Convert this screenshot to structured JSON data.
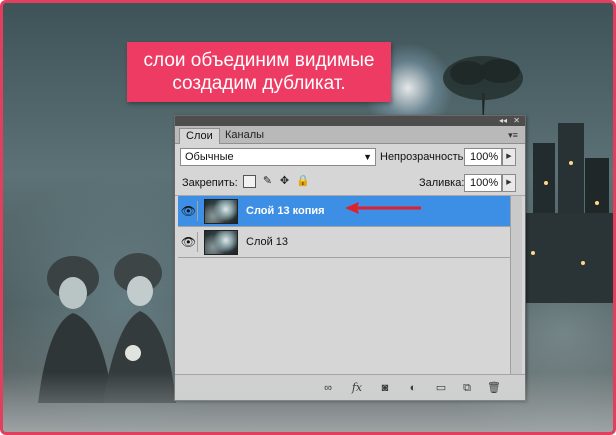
{
  "caption": {
    "line1": "слои объединим видимые",
    "line2": "создадим дубликат."
  },
  "panel": {
    "top_controls": [
      "◂◂",
      "✕"
    ],
    "tabs": [
      {
        "label": "Слои",
        "active": true
      },
      {
        "label": "Каналы",
        "active": false
      }
    ],
    "menu_icon": "panel-menu-icon",
    "blend_mode": "Обычные",
    "opacity_label": "Непрозрачность:",
    "opacity_value": "100%",
    "lock_label": "Закрепить:",
    "fill_label": "Заливка:",
    "fill_value": "100%",
    "layers": [
      {
        "name": "Слой 13 копия",
        "selected": true,
        "visible": true
      },
      {
        "name": "Слой 13",
        "selected": false,
        "visible": true
      }
    ],
    "bottom_icons": [
      "link-icon",
      "fx-icon",
      "mask-icon",
      "adjustment-icon",
      "folder-icon",
      "new-layer-icon",
      "trash-icon"
    ],
    "selection_color": "#3d8ee5"
  },
  "accent": "#ee3b63"
}
